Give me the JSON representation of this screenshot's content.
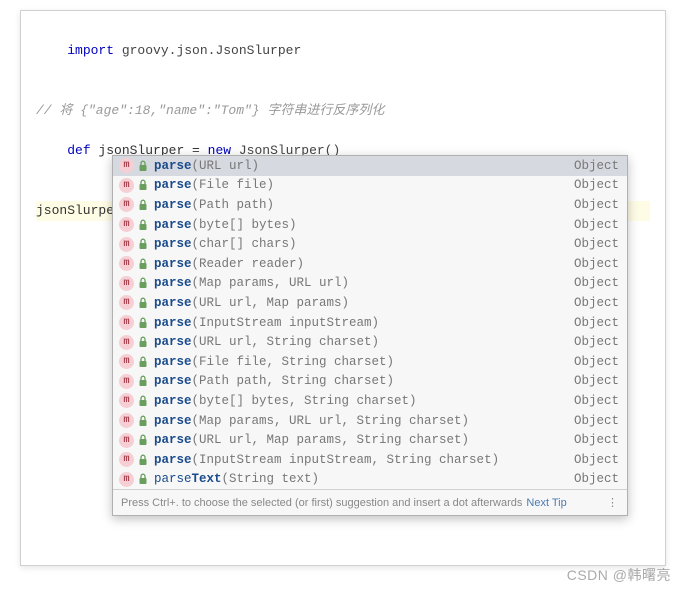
{
  "code": {
    "line1_kw": "import",
    "line1_pkg": " groovy.json.JsonSlurper",
    "line3_comment": "// 将 {\"age\":18,\"name\":\"Tom\"} 字符串进行反序列化",
    "line4_kw1": "def",
    "line4_var": " jsonSlurper = ",
    "line4_kw2": "new",
    "line4_cls": " JsonSlurper()",
    "typed": "jsonSlurper.parse"
  },
  "completion": {
    "items": [
      {
        "name": "parse",
        "params": "(URL url)",
        "ret": "Object"
      },
      {
        "name": "parse",
        "params": "(File file)",
        "ret": "Object"
      },
      {
        "name": "parse",
        "params": "(Path path)",
        "ret": "Object"
      },
      {
        "name": "parse",
        "params": "(byte[] bytes)",
        "ret": "Object"
      },
      {
        "name": "parse",
        "params": "(char[] chars)",
        "ret": "Object"
      },
      {
        "name": "parse",
        "params": "(Reader reader)",
        "ret": "Object"
      },
      {
        "name": "parse",
        "params": "(Map params, URL url)",
        "ret": "Object"
      },
      {
        "name": "parse",
        "params": "(URL url, Map params)",
        "ret": "Object"
      },
      {
        "name": "parse",
        "params": "(InputStream inputStream)",
        "ret": "Object"
      },
      {
        "name": "parse",
        "params": "(URL url, String charset)",
        "ret": "Object"
      },
      {
        "name": "parse",
        "params": "(File file, String charset)",
        "ret": "Object"
      },
      {
        "name": "parse",
        "params": "(Path path, String charset)",
        "ret": "Object"
      },
      {
        "name": "parse",
        "params": "(byte[] bytes, String charset)",
        "ret": "Object"
      },
      {
        "name": "parse",
        "params": "(Map params, URL url, String charset)",
        "ret": "Object"
      },
      {
        "name": "parse",
        "params": "(URL url, Map params, String charset)",
        "ret": "Object"
      },
      {
        "name": "parse",
        "params": "(InputStream inputStream, String charset)",
        "ret": "Object"
      },
      {
        "name": "parseText",
        "name_prefix": "parse",
        "name_bold": "Text",
        "params": "(String text)",
        "ret": "Object"
      }
    ],
    "footer_text": "Press Ctrl+. to choose the selected (or first) suggestion and insert a dot afterwards",
    "next_tip": "Next Tip",
    "dots": "⋮"
  },
  "watermark": "CSDN @韩曙亮"
}
